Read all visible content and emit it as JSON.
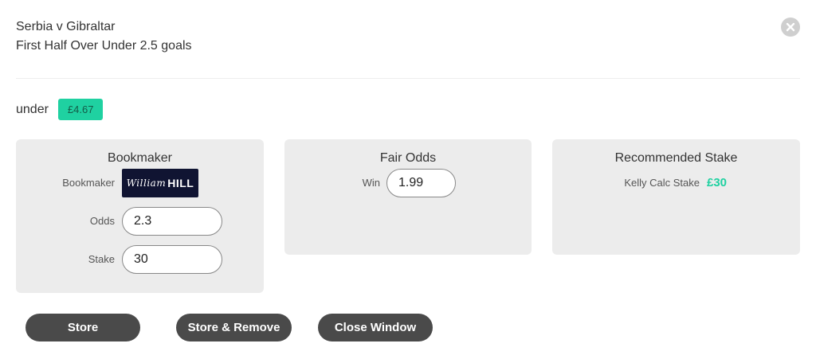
{
  "header": {
    "match": "Serbia v Gibraltar",
    "market": "First Half Over Under 2.5 goals"
  },
  "selection": {
    "label": "under",
    "badge": "£4.67"
  },
  "bookmaker_panel": {
    "title": "Bookmaker",
    "bookmaker_label": "Bookmaker",
    "logo": {
      "script": "William",
      "bold": "HILL"
    },
    "odds_label": "Odds",
    "odds_value": "2.3",
    "stake_label": "Stake",
    "stake_value": "30"
  },
  "fair_odds_panel": {
    "title": "Fair Odds",
    "win_label": "Win",
    "win_value": "1.99"
  },
  "stake_panel": {
    "title": "Recommended Stake",
    "kelly_label": "Kelly Calc Stake",
    "kelly_value": "£30"
  },
  "buttons": {
    "store": "Store",
    "store_remove": "Store & Remove",
    "close_window": "Close Window"
  },
  "colors": {
    "accent": "#1fd1a1",
    "button": "#4a4a4a",
    "panel": "#ececec"
  },
  "icons": {
    "close": "close-icon"
  }
}
